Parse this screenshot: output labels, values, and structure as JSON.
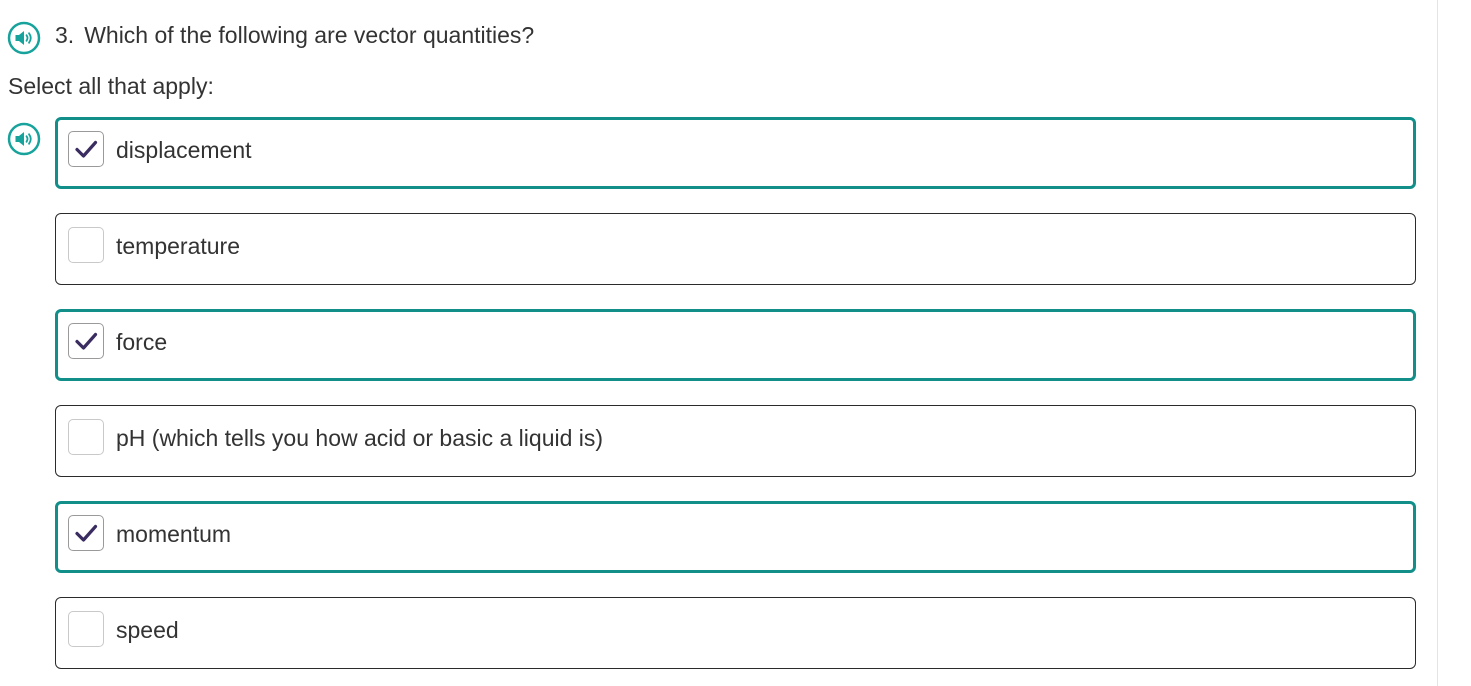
{
  "question": {
    "number": "3.",
    "text": "Which of the following are vector quantities?"
  },
  "instruction": "Select all that apply:",
  "icons": {
    "audio": "speaker-icon",
    "check": "checkmark-icon"
  },
  "colors": {
    "accent_teal": "#138f8a",
    "check_purple": "#3a2c60",
    "text": "#333333"
  },
  "options": [
    {
      "label": "displacement",
      "checked": true
    },
    {
      "label": "temperature",
      "checked": false
    },
    {
      "label": "force",
      "checked": true
    },
    {
      "label": "pH (which tells you how acid or basic a liquid is)",
      "checked": false
    },
    {
      "label": "momentum",
      "checked": true
    },
    {
      "label": "speed",
      "checked": false
    }
  ]
}
